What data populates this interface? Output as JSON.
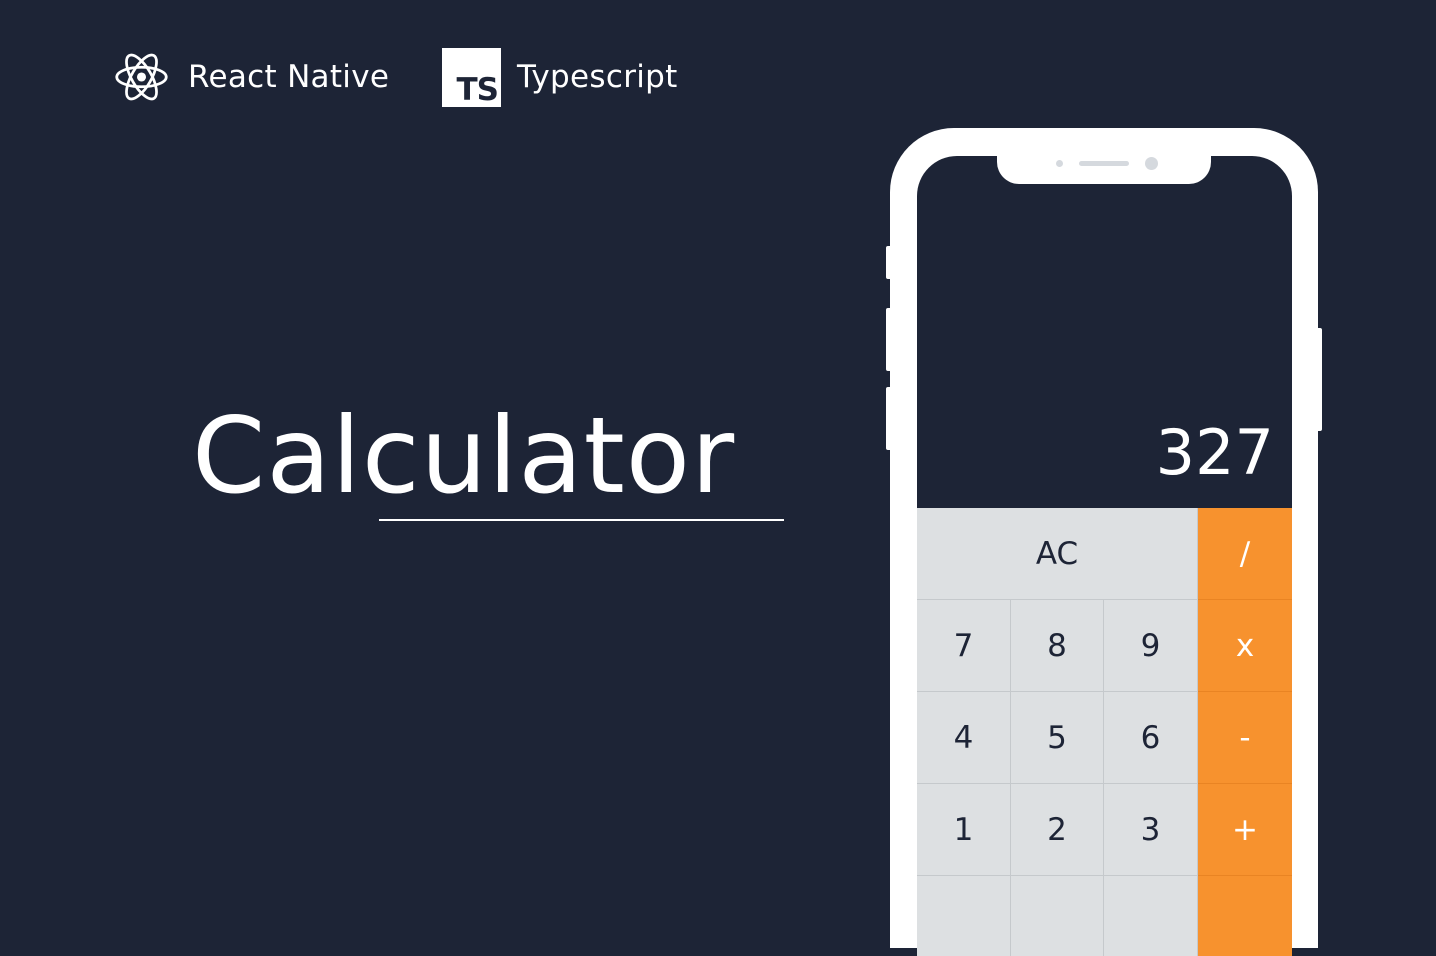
{
  "header": {
    "tech": [
      {
        "icon": "react-atom-icon",
        "label": "React Native"
      },
      {
        "icon": "typescript-logo-icon",
        "logo_text": "TS",
        "label": "Typescript"
      }
    ]
  },
  "hero": {
    "title": "Calculator"
  },
  "calculator": {
    "display": "327",
    "keys": {
      "clear": "AC",
      "divide": "/",
      "seven": "7",
      "eight": "8",
      "nine": "9",
      "multiply": "x",
      "four": "4",
      "five": "5",
      "six": "6",
      "subtract": "-",
      "one": "1",
      "two": "2",
      "three": "3",
      "add": "+"
    }
  },
  "colors": {
    "background": "#1d2436",
    "operator": "#f7922e",
    "key": "#dde0e2",
    "phone_frame": "#ffffff"
  }
}
